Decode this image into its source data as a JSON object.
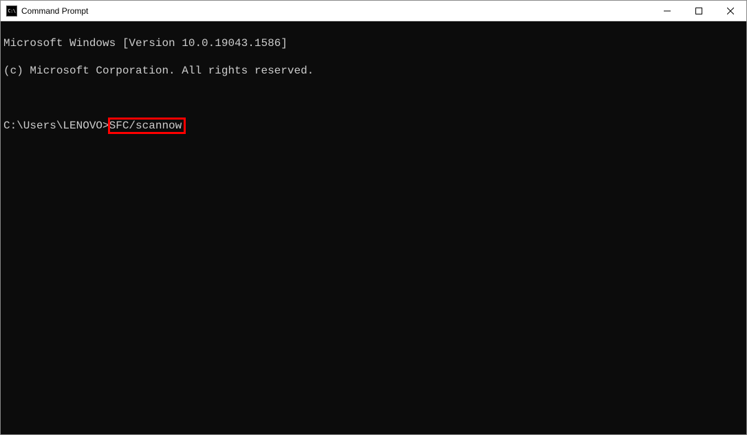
{
  "window": {
    "title": "Command Prompt",
    "icon_label": "cmd-icon"
  },
  "terminal": {
    "line1": "Microsoft Windows [Version 10.0.19043.1586]",
    "line2": "(c) Microsoft Corporation. All rights reserved.",
    "prompt": "C:\\Users\\LENOVO>",
    "command": "SFC/scannow"
  },
  "highlight_color": "#ff0000"
}
